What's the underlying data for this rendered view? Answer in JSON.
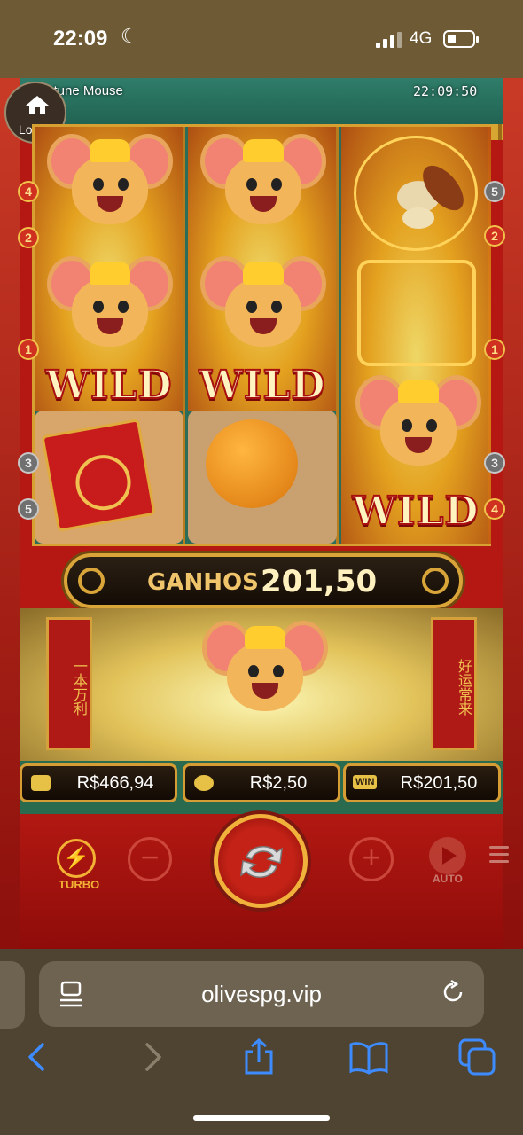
{
  "status_bar": {
    "time": "22:09",
    "network": "4G"
  },
  "game": {
    "title": "Fortune Mouse",
    "clock": "22:09:50",
    "lobby_label": "Lobby",
    "reels": {
      "wild_label": "WILD",
      "payline_left": [
        "4",
        "2",
        "1",
        "3",
        "5"
      ],
      "payline_right": [
        "5",
        "2",
        "1",
        "3",
        "4"
      ]
    },
    "win_banner": {
      "label": "GANHOS",
      "value": "201,50"
    },
    "pillar_left_text": "一本万利",
    "pillar_right_text": "好运常来",
    "stats": {
      "balance": "R$466,94",
      "bet": "R$2,50",
      "win_badge": "WIN",
      "win": "R$201,50"
    },
    "controls": {
      "turbo_label": "TURBO",
      "minus": "−",
      "plus": "+",
      "auto_label": "AUTO"
    }
  },
  "browser": {
    "url": "olivespg.vip"
  },
  "colors": {
    "gold": "#d9a539",
    "red": "#b51712",
    "browser_bg": "#4e4431"
  }
}
